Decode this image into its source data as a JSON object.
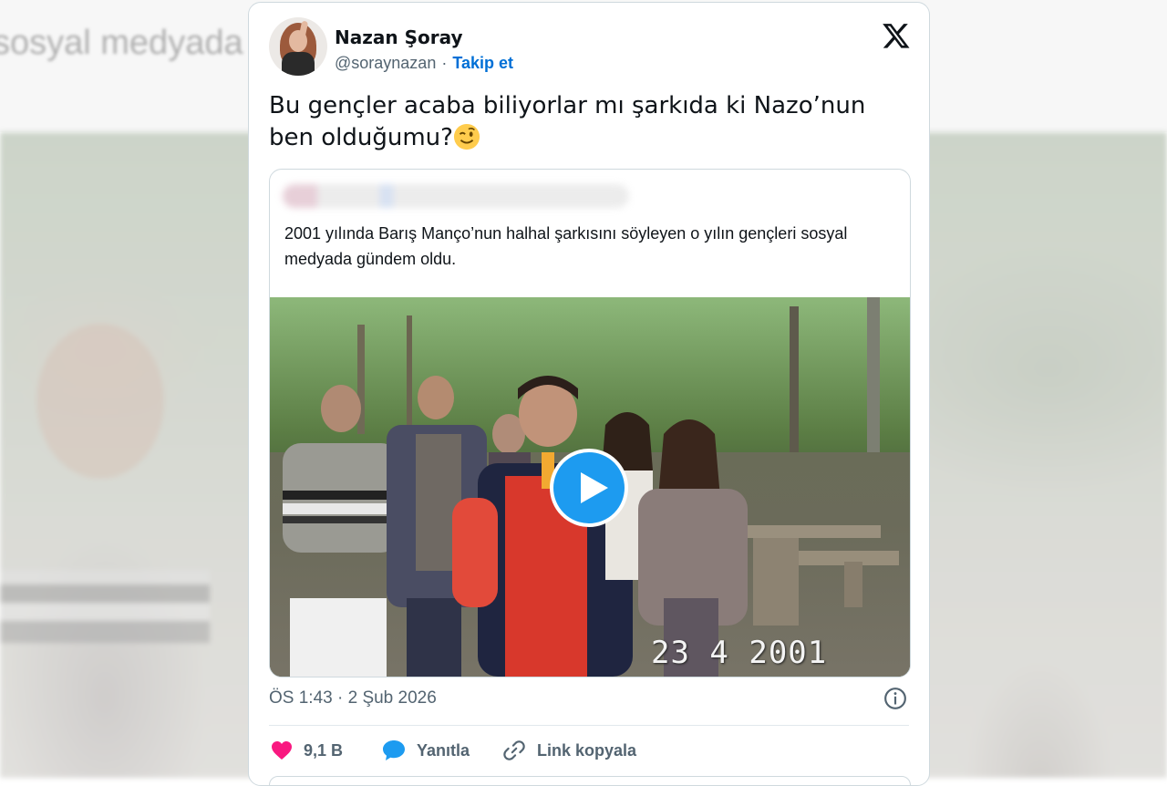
{
  "background": {
    "caption_line1": "2001 yılında Barış Manço'nun halhal şarkısını söyleyen o yılın gençleri",
    "caption_line2": "sosyal medyada gündem oldu."
  },
  "tweet": {
    "author_name": "Nazan Şoray",
    "handle": "@soraynazan",
    "separator": "·",
    "follow_label": "Takip et",
    "text": "Bu gençler acaba biliyorlar mı şarkıda ki Nazo’nun ben olduğumu?",
    "timestamp": "ÖS 1:43 · 2 Şub 2026",
    "icons": [
      "avatar",
      "x-logo-icon",
      "wink-emoji-icon",
      "play-icon",
      "info-icon",
      "heart-icon",
      "reply-bubble-icon",
      "link-icon"
    ]
  },
  "quote": {
    "text": "2001 yılında Barış Manço’nun halhal şarkısını söyleyen o yılın gençleri sosyal medyada gündem oldu.",
    "video_date_overlay": "23  4 2001"
  },
  "actions": {
    "like_count": "9,1 B",
    "reply_label": "Yanıtla",
    "copy_link_label": "Link kopyala"
  },
  "colors": {
    "accent_blue": "#1d9bf0",
    "follow_blue": "#006fd6",
    "like_pink": "#f91880",
    "muted_text": "#536471"
  }
}
